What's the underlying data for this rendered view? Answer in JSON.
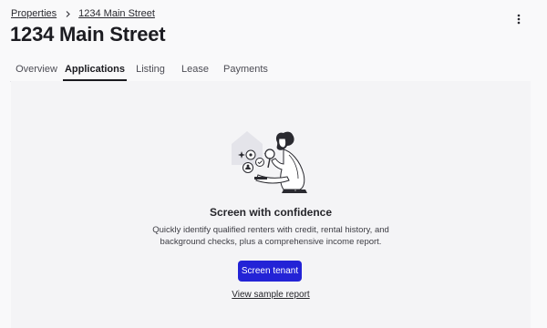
{
  "breadcrumb": {
    "parent": "Properties",
    "current": "1234 Main Street"
  },
  "page_title": "1234 Main Street",
  "menu_icon": "more-vertical-icon",
  "tabs": [
    {
      "label": "Overview",
      "active": false
    },
    {
      "label": "Applications",
      "active": true
    },
    {
      "label": "Listing",
      "active": false
    },
    {
      "label": "Lease",
      "active": false
    },
    {
      "label": "Payments",
      "active": false
    }
  ],
  "empty_state": {
    "illustration": "tenant-screening-illustration",
    "headline": "Screen with confidence",
    "description": "Quickly identify qualified renters with credit, rental history, and background checks, plus a comprehensive income report.",
    "primary_button": "Screen tenant",
    "secondary_link": "View sample report"
  },
  "colors": {
    "accent": "#2323d6",
    "panel_bg": "#f4f4f6",
    "page_bg": "#f9f9fa"
  }
}
